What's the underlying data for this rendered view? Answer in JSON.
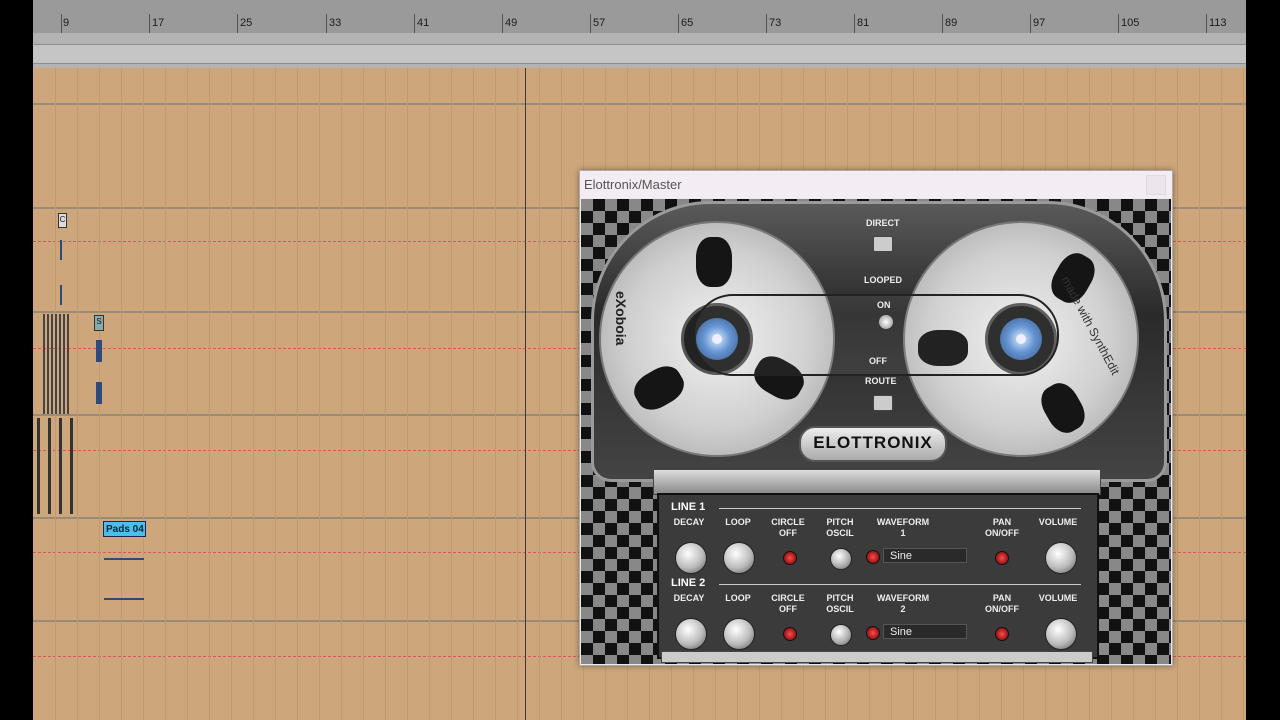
{
  "ruler": {
    "labels": [
      "9",
      "17",
      "25",
      "33",
      "41",
      "49",
      "57",
      "65",
      "73",
      "81",
      "89",
      "97",
      "105",
      "113"
    ]
  },
  "tracks": {
    "clip_marks": [
      "C",
      "S"
    ],
    "pads_clip_label": "Pads 04"
  },
  "plugin": {
    "window_title": "Elottronix/Master",
    "logo_left": "eXoboia",
    "made_with": "made with SynthEdit",
    "brand": "ELOTTRONIX",
    "switches": {
      "direct": "DIRECT",
      "looped": "LOOPED",
      "on": "ON",
      "off": "OFF",
      "route": "ROUTE"
    },
    "line1": {
      "header": "LINE 1",
      "labels": {
        "decay": "DECAY",
        "loop": "LOOP",
        "circle": "CIRCLE\nOFF",
        "pitch": "PITCH\nOSCIL",
        "waveform": "WAVEFORM\n1",
        "pan": "PAN\nON/OFF",
        "volume": "VOLUME"
      },
      "waveform_value": "Sine"
    },
    "line2": {
      "header": "LINE 2",
      "labels": {
        "decay": "DECAY",
        "loop": "LOOP",
        "circle": "CIRCLE\nOFF",
        "pitch": "PITCH\nOSCIL",
        "waveform": "WAVEFORM\n2",
        "pan": "PAN\nON/OFF",
        "volume": "VOLUME"
      },
      "waveform_value": "Sine"
    }
  }
}
